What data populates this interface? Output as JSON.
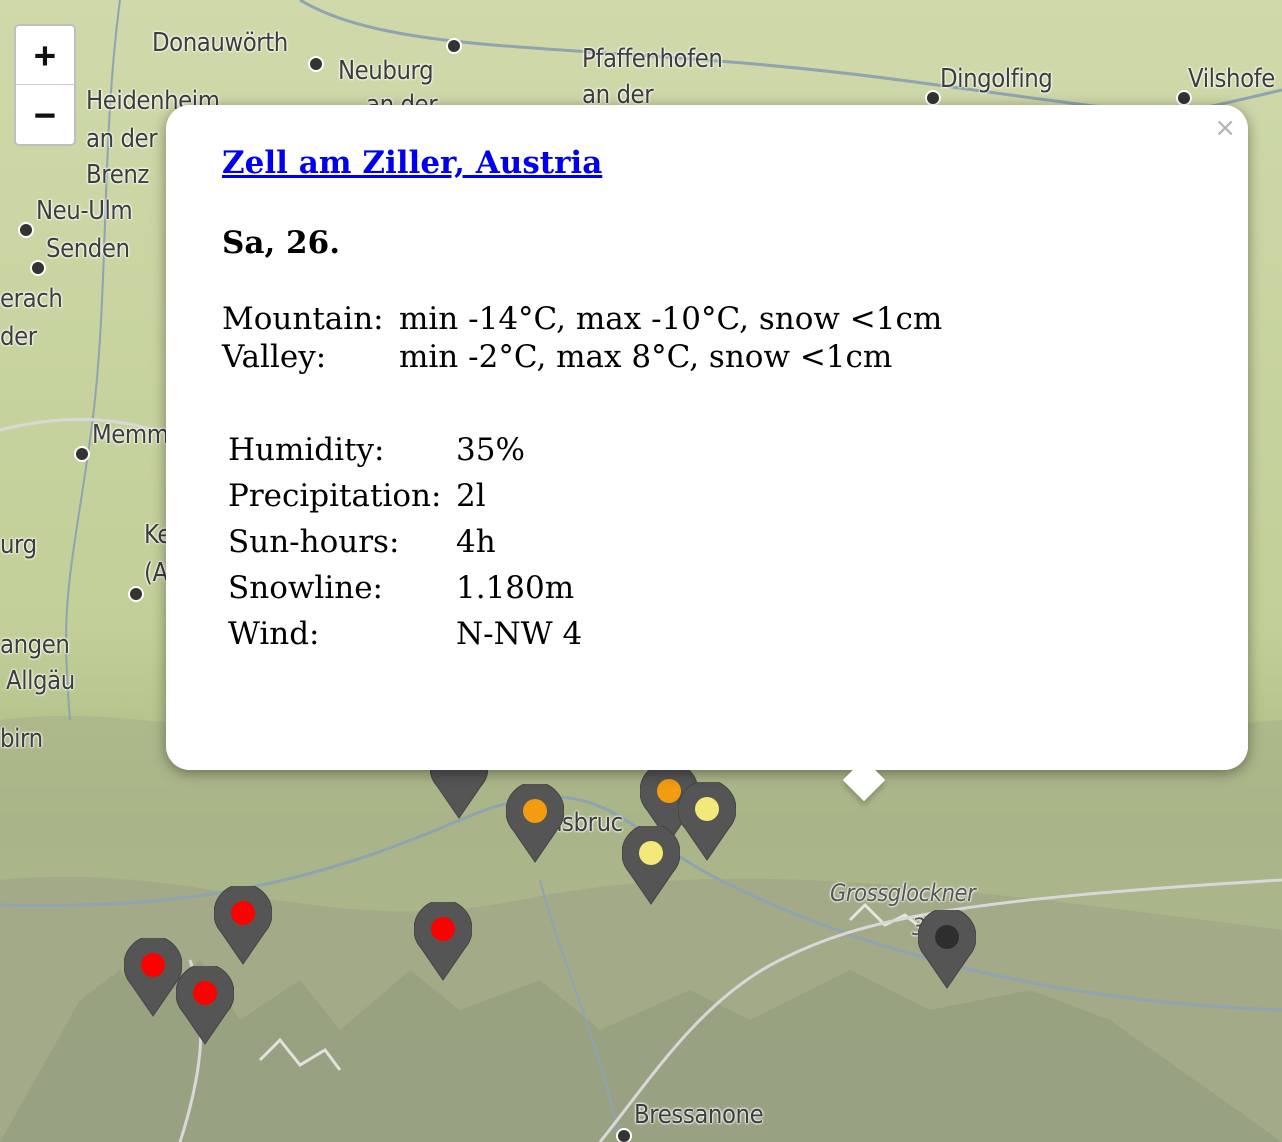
{
  "map": {
    "places": [
      {
        "id": "donauworth",
        "label": "Donauwörth"
      },
      {
        "id": "neuburg",
        "label": "Neuburg"
      },
      {
        "id": "neuburg2",
        "label": "an der"
      },
      {
        "id": "pfaffenhofen",
        "label": "Pfaffenhofen"
      },
      {
        "id": "pfaffenhofen2",
        "label": "an der"
      },
      {
        "id": "dingolfing",
        "label": "Dingolfing"
      },
      {
        "id": "vilshofen",
        "label": "Vilshofe"
      },
      {
        "id": "heidenheim",
        "label": "Heidenheim"
      },
      {
        "id": "heidenheim2",
        "label": "an der"
      },
      {
        "id": "heidenheim3",
        "label": "Brenz"
      },
      {
        "id": "neuulm",
        "label": "Neu-Ulm"
      },
      {
        "id": "senden",
        "label": "Senden"
      },
      {
        "id": "biberach1",
        "label": "erach"
      },
      {
        "id": "biberach2",
        "label": "der"
      },
      {
        "id": "memmingen",
        "label": "Memm"
      },
      {
        "id": "ravensburg",
        "label": "urg"
      },
      {
        "id": "kempten1",
        "label": "Ke"
      },
      {
        "id": "kempten2",
        "label": "(A"
      },
      {
        "id": "wangen1",
        "label": "angen"
      },
      {
        "id": "wangen2",
        "label": "Allgäu"
      },
      {
        "id": "dornbirn",
        "label": "birn"
      },
      {
        "id": "innsbruck",
        "label": "nsbruc"
      },
      {
        "id": "grossglockner",
        "label": "Grossglockner"
      },
      {
        "id": "grossglockner_alt",
        "label": "3...m"
      },
      {
        "id": "bressanone",
        "label": "Bressanone"
      }
    ],
    "zoom": {
      "in_label": "+",
      "out_label": "−"
    },
    "marker_colors": {
      "red": "#ff0000",
      "orange": "#f39c12",
      "yellow": "#f5e87a",
      "dark": "#2e2e2e",
      "pin": "#555555"
    }
  },
  "popup": {
    "close_label": "×",
    "title": "Zell am Ziller, Austria",
    "date": "Sa, 26.",
    "mountain_label": "Mountain:",
    "mountain_value": "min -14°C, max -10°C, snow <1cm",
    "valley_label": "Valley:",
    "valley_value": "min -2°C, max 8°C, snow <1cm",
    "stats": [
      {
        "label": "Humidity:",
        "value": "35%"
      },
      {
        "label": "Precipitation:",
        "value": "2l"
      },
      {
        "label": "Sun-hours:",
        "value": "4h"
      },
      {
        "label": "Snowline:",
        "value": "1.180m"
      },
      {
        "label": "Wind:",
        "value": "N-NW 4"
      }
    ]
  }
}
